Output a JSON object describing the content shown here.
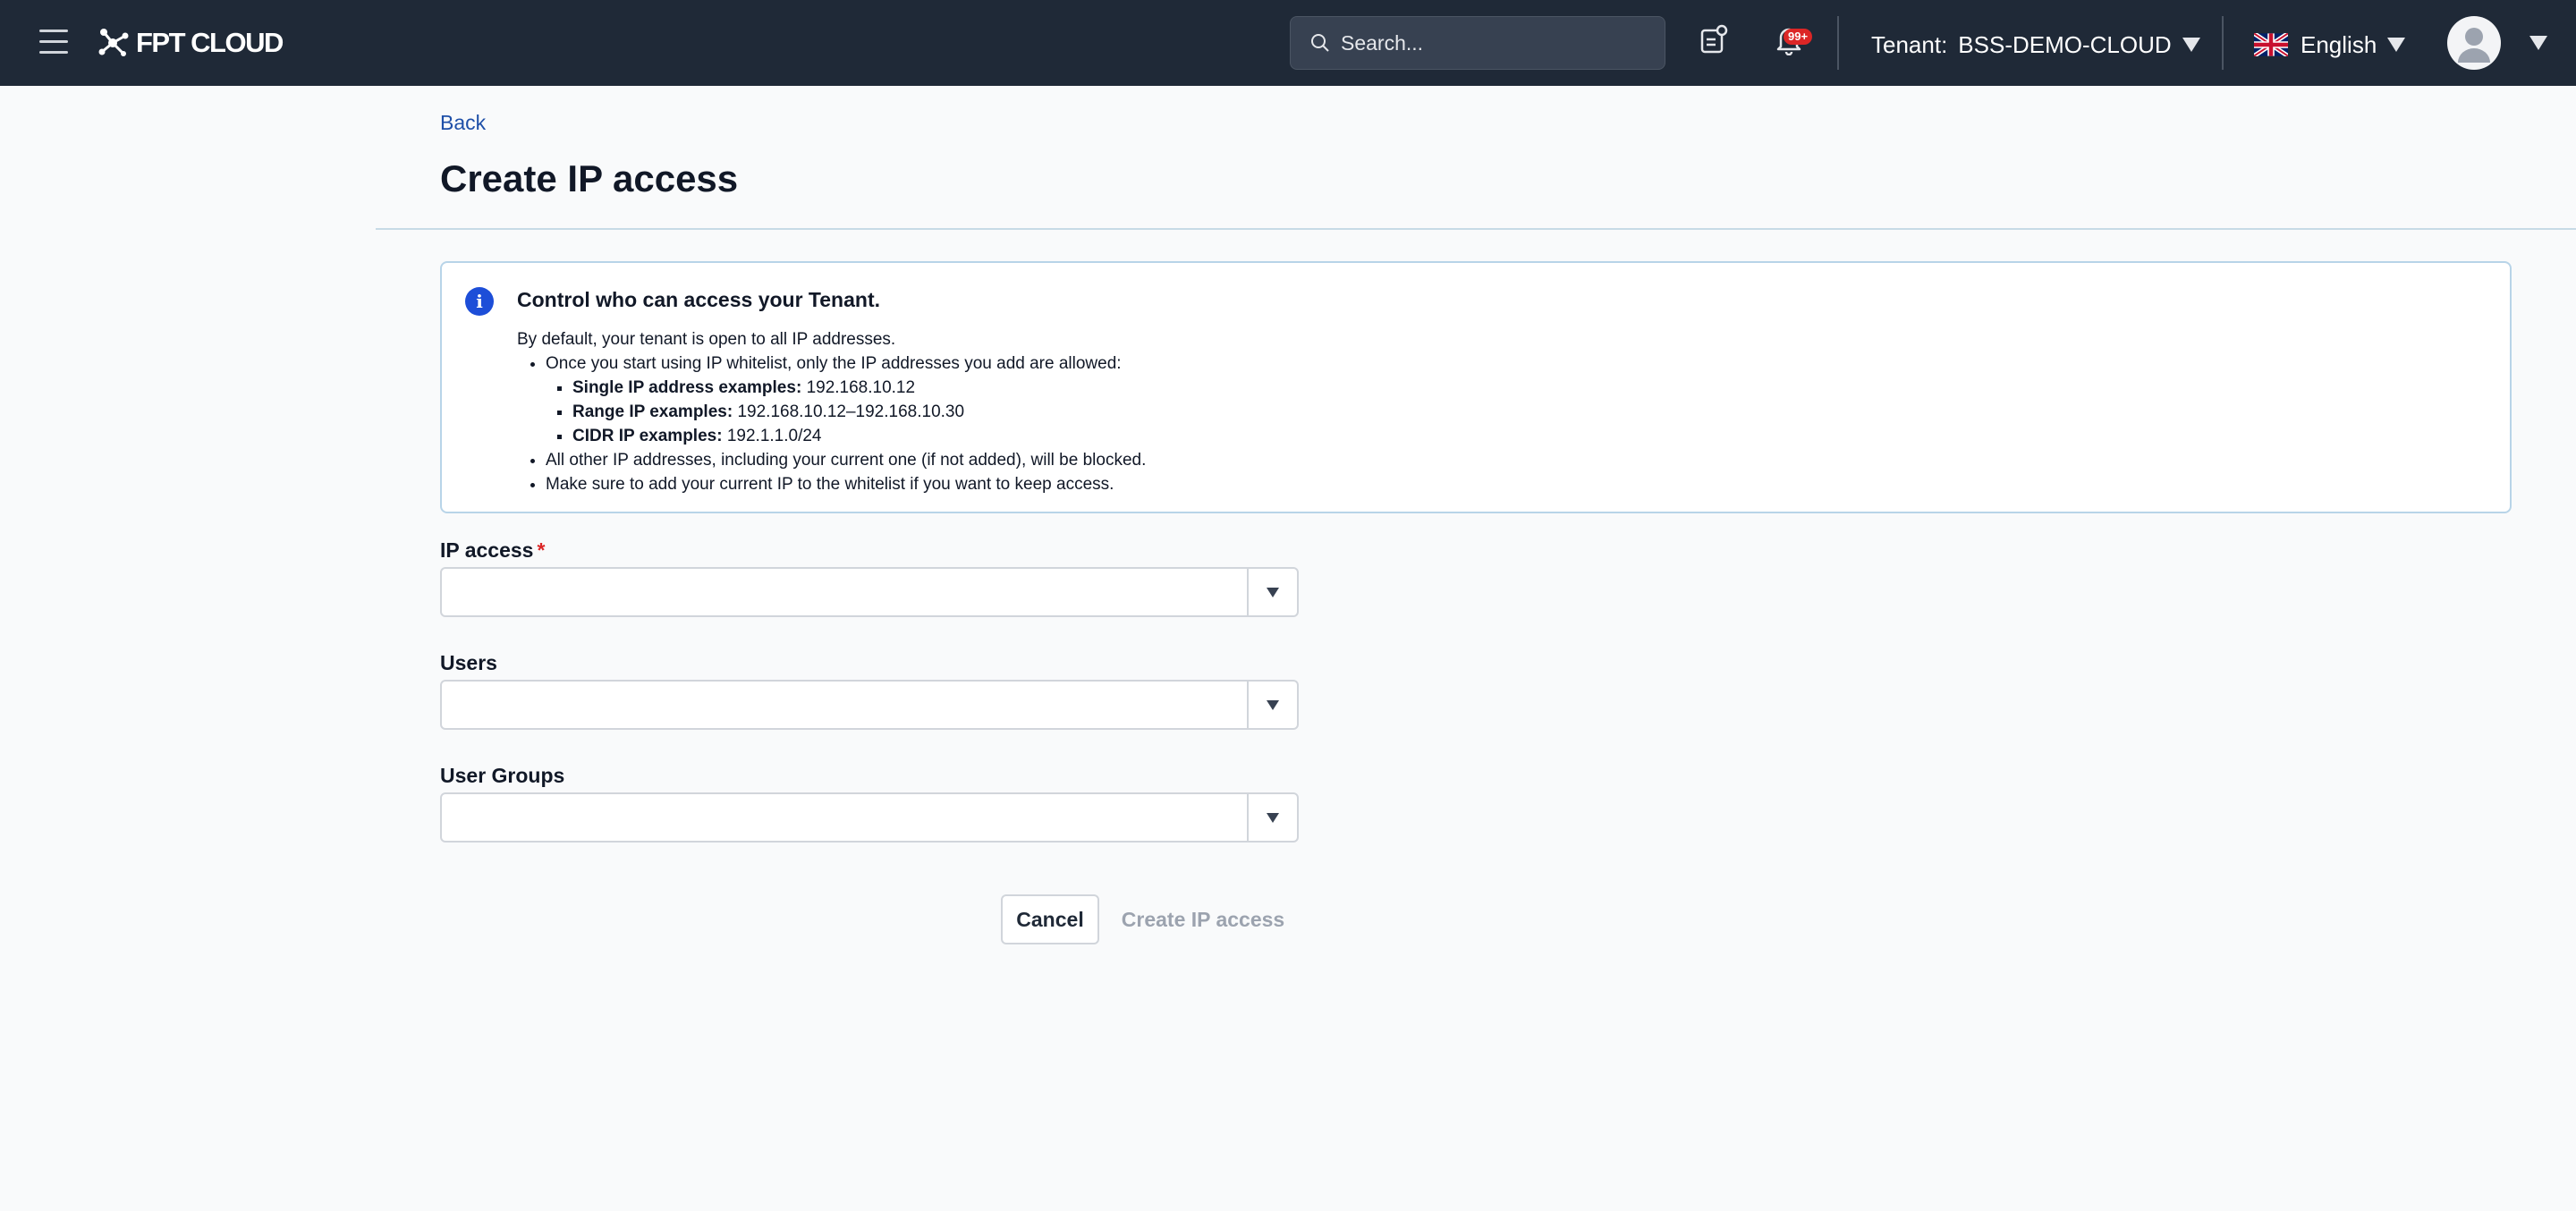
{
  "header": {
    "brand": "FPT CLOUD",
    "search_placeholder": "Search...",
    "notification_badge": "99+",
    "tenant_label": "Tenant:",
    "tenant_value": "BSS-DEMO-CLOUD",
    "language": "English"
  },
  "page": {
    "back_label": "Back",
    "title": "Create IP access"
  },
  "info": {
    "title": "Control who can access your Tenant.",
    "intro": "By default, your tenant is open to all IP addresses.",
    "bullet1": "Once you start using IP whitelist, only the IP addresses you add are allowed:",
    "examples": [
      {
        "label": "Single IP address examples:",
        "value": "192.168.10.12"
      },
      {
        "label": "Range IP examples:",
        "value": "192.168.10.12–192.168.10.30"
      },
      {
        "label": "CIDR IP examples:",
        "value": "192.1.1.0/24"
      }
    ],
    "bullet2": "All other IP addresses, including your current one (if not added), will be blocked.",
    "bullet3": "Make sure to add your current IP to the whitelist if you want to keep access."
  },
  "form": {
    "ip_access_label": "IP access",
    "required_mark": "*",
    "users_label": "Users",
    "user_groups_label": "User Groups"
  },
  "actions": {
    "cancel": "Cancel",
    "create": "Create IP access"
  },
  "colors": {
    "topbar": "#1f2937",
    "accent": "#1d4ed8",
    "link": "#1e4fa8",
    "required": "#dc2626",
    "disabled_text": "#9ca3af"
  }
}
